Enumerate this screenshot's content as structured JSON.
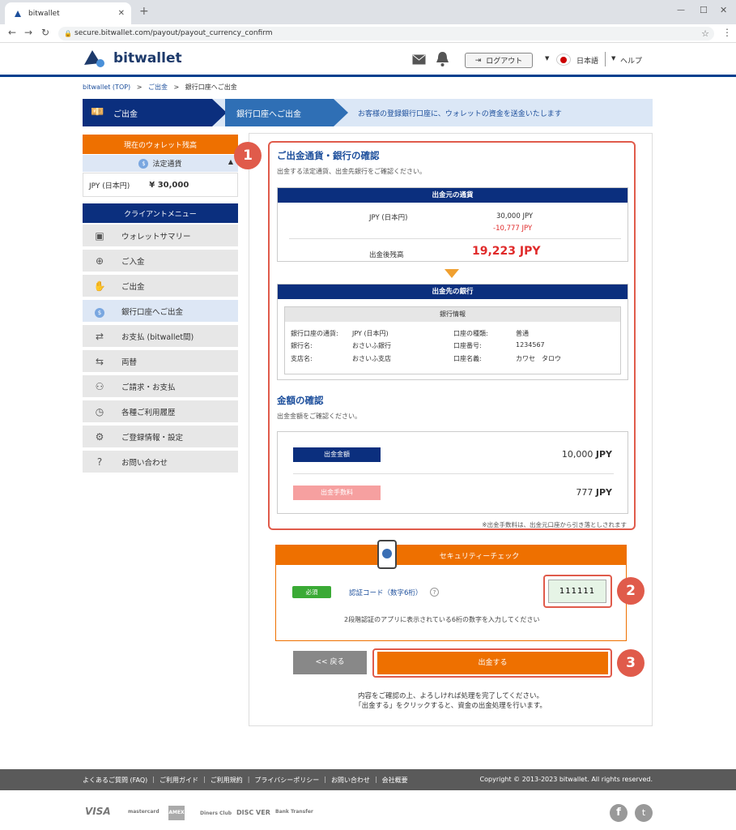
{
  "browser": {
    "tab_title": "bitwallet",
    "url": "secure.bitwallet.com/payout/payout_currency_confirm"
  },
  "header": {
    "logo": "bitwallet",
    "logout": "ログアウト",
    "language": "日本語",
    "help": "ヘルプ"
  },
  "breadcrumb": {
    "top": "bitwallet (TOP)",
    "sep": ">",
    "deposit_out": "ご出金",
    "current": "銀行口座へご出金"
  },
  "steps": {
    "step1": "ご出金",
    "step2": "銀行口座へご出金",
    "description": "お客様の登録銀行口座に、ウォレットの資金を送金いたします"
  },
  "sidebar": {
    "balance_title": "現在のウォレット残高",
    "fiat_label": "法定通貨",
    "balance_currency": "JPY (日本円)",
    "balance_amount": "¥ 30,000",
    "menu_title": "クライアントメニュー",
    "items": [
      {
        "label": "ウォレットサマリー",
        "icon": "wallet-icon"
      },
      {
        "label": "ご入金",
        "icon": "deposit-icon"
      },
      {
        "label": "ご出金",
        "icon": "withdraw-icon"
      },
      {
        "label": "銀行口座へご出金",
        "icon": "coin-icon"
      },
      {
        "label": "お支払 (bitwallet間)",
        "icon": "transfer-icon"
      },
      {
        "label": "両替",
        "icon": "exchange-icon"
      },
      {
        "label": "ご請求・お支払",
        "icon": "users-icon"
      },
      {
        "label": "各種ご利用履歴",
        "icon": "history-icon"
      },
      {
        "label": "ご登録情報・設定",
        "icon": "gear-icon"
      },
      {
        "label": "お問い合わせ",
        "icon": "question-icon"
      }
    ]
  },
  "confirm": {
    "title": "ご出金通貨・銀行の確認",
    "subtitle": "出金する法定通貨、出金先銀行をご確認ください。",
    "source_head": "出金元の通貨",
    "source_currency": "JPY (日本円)",
    "source_amount": "30,000 JPY",
    "source_minus": "-10,777 JPY",
    "after_label": "出金後残高",
    "after_amount": "19,223 JPY",
    "dest_head": "出金先の銀行",
    "bank_info": "銀行情報",
    "bank_rows": [
      {
        "k1": "銀行口座の通貨:",
        "v1": "JPY (日本円)",
        "k2": "口座の種類:",
        "v2": "普通"
      },
      {
        "k1": "銀行名:",
        "v1": "おさいふ銀行",
        "k2": "口座番号:",
        "v2": "1234567"
      },
      {
        "k1": "支店名:",
        "v1": "おさいふ支店",
        "k2": "口座名義:",
        "v2": "カワセ　タロウ"
      }
    ],
    "amount_title": "金額の確認",
    "amount_sub": "出金金額をご確認ください。",
    "withdraw_label": "出金金額",
    "withdraw_value": "10,000",
    "fee_label": "出金手数料",
    "fee_value": "777",
    "unit": "JPY",
    "fee_note": "※出金手数料は、出金元口座から引き落としされます"
  },
  "security": {
    "title": "セキュリティーチェック",
    "required": "必須",
    "code_label": "認証コード（数字6桁）",
    "code_value": "111111",
    "hint": "2段階認証のアプリに表示されている6桁の数字を入力してください"
  },
  "actions": {
    "back": "<< 戻る",
    "submit": "出金する",
    "note1": "内容をご確認の上、よろしければ処理を完了してください。",
    "note2": "「出金する」をクリックすると、資金の出金処理を行います。"
  },
  "markers": [
    "1",
    "2",
    "3"
  ],
  "footer": {
    "links": [
      "よくあるご質問 (FAQ)",
      "ご利用ガイド",
      "ご利用規約",
      "プライバシーポリシー",
      "お問い合わせ",
      "会社概要"
    ],
    "copyright": "Copyright © 2013-2023 bitwallet. All rights reserved.",
    "pay": [
      "VISA",
      "mastercard",
      "AMEX",
      "Diners Club",
      "DISC VER",
      "Bank Transfer"
    ]
  },
  "colors": {
    "navy": "#0b2f7e",
    "orange": "#ee7000",
    "red": "#e05b4b",
    "redtext": "#e02b2b"
  }
}
